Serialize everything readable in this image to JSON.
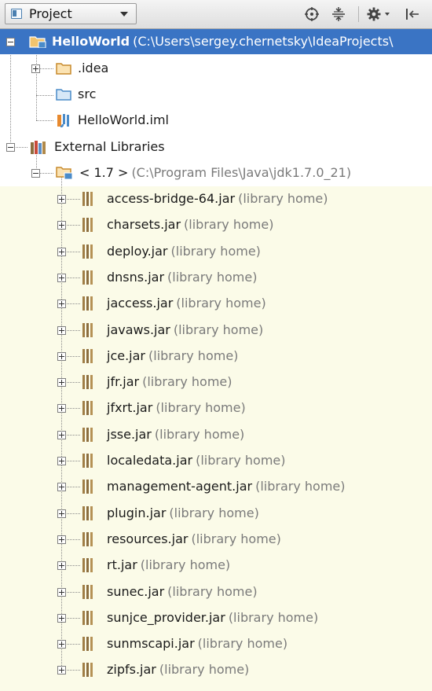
{
  "toolbar": {
    "view_selector_label": "Project",
    "icons": [
      "scroll-from-source-icon",
      "collapse-all-icon",
      "settings-icon",
      "hide-icon"
    ]
  },
  "colors": {
    "selection": "#3a74c4",
    "library_band": "#fbfbe8",
    "hint_text": "#7a7a7a",
    "folder_orange": "#c78a2c",
    "folder_blue": "#4a8bc9",
    "jar_brown": "#8c6e3f"
  },
  "tree": {
    "root": {
      "name": "HelloWorld",
      "hint": "(C:\\Users\\sergey.chernetsky\\IdeaProjects\\"
    },
    "idea": {
      "name": ".idea"
    },
    "src": {
      "name": "src"
    },
    "iml": {
      "name": "HelloWorld.iml"
    },
    "external_libraries": {
      "name": "External Libraries"
    },
    "jdk": {
      "name": "< 1.7 >",
      "hint": "(C:\\Program Files\\Java\\jdk1.7.0_21)"
    },
    "jars": [
      {
        "name": "access-bridge-64.jar",
        "hint": "(library home)"
      },
      {
        "name": "charsets.jar",
        "hint": "(library home)"
      },
      {
        "name": "deploy.jar",
        "hint": "(library home)"
      },
      {
        "name": "dnsns.jar",
        "hint": "(library home)"
      },
      {
        "name": "jaccess.jar",
        "hint": "(library home)"
      },
      {
        "name": "javaws.jar",
        "hint": "(library home)"
      },
      {
        "name": "jce.jar",
        "hint": "(library home)"
      },
      {
        "name": "jfr.jar",
        "hint": "(library home)"
      },
      {
        "name": "jfxrt.jar",
        "hint": "(library home)"
      },
      {
        "name": "jsse.jar",
        "hint": "(library home)"
      },
      {
        "name": "localedata.jar",
        "hint": "(library home)"
      },
      {
        "name": "management-agent.jar",
        "hint": "(library home)"
      },
      {
        "name": "plugin.jar",
        "hint": "(library home)"
      },
      {
        "name": "resources.jar",
        "hint": "(library home)"
      },
      {
        "name": "rt.jar",
        "hint": "(library home)"
      },
      {
        "name": "sunec.jar",
        "hint": "(library home)"
      },
      {
        "name": "sunjce_provider.jar",
        "hint": "(library home)"
      },
      {
        "name": "sunmscapi.jar",
        "hint": "(library home)"
      },
      {
        "name": "zipfs.jar",
        "hint": "(library home)"
      }
    ]
  }
}
